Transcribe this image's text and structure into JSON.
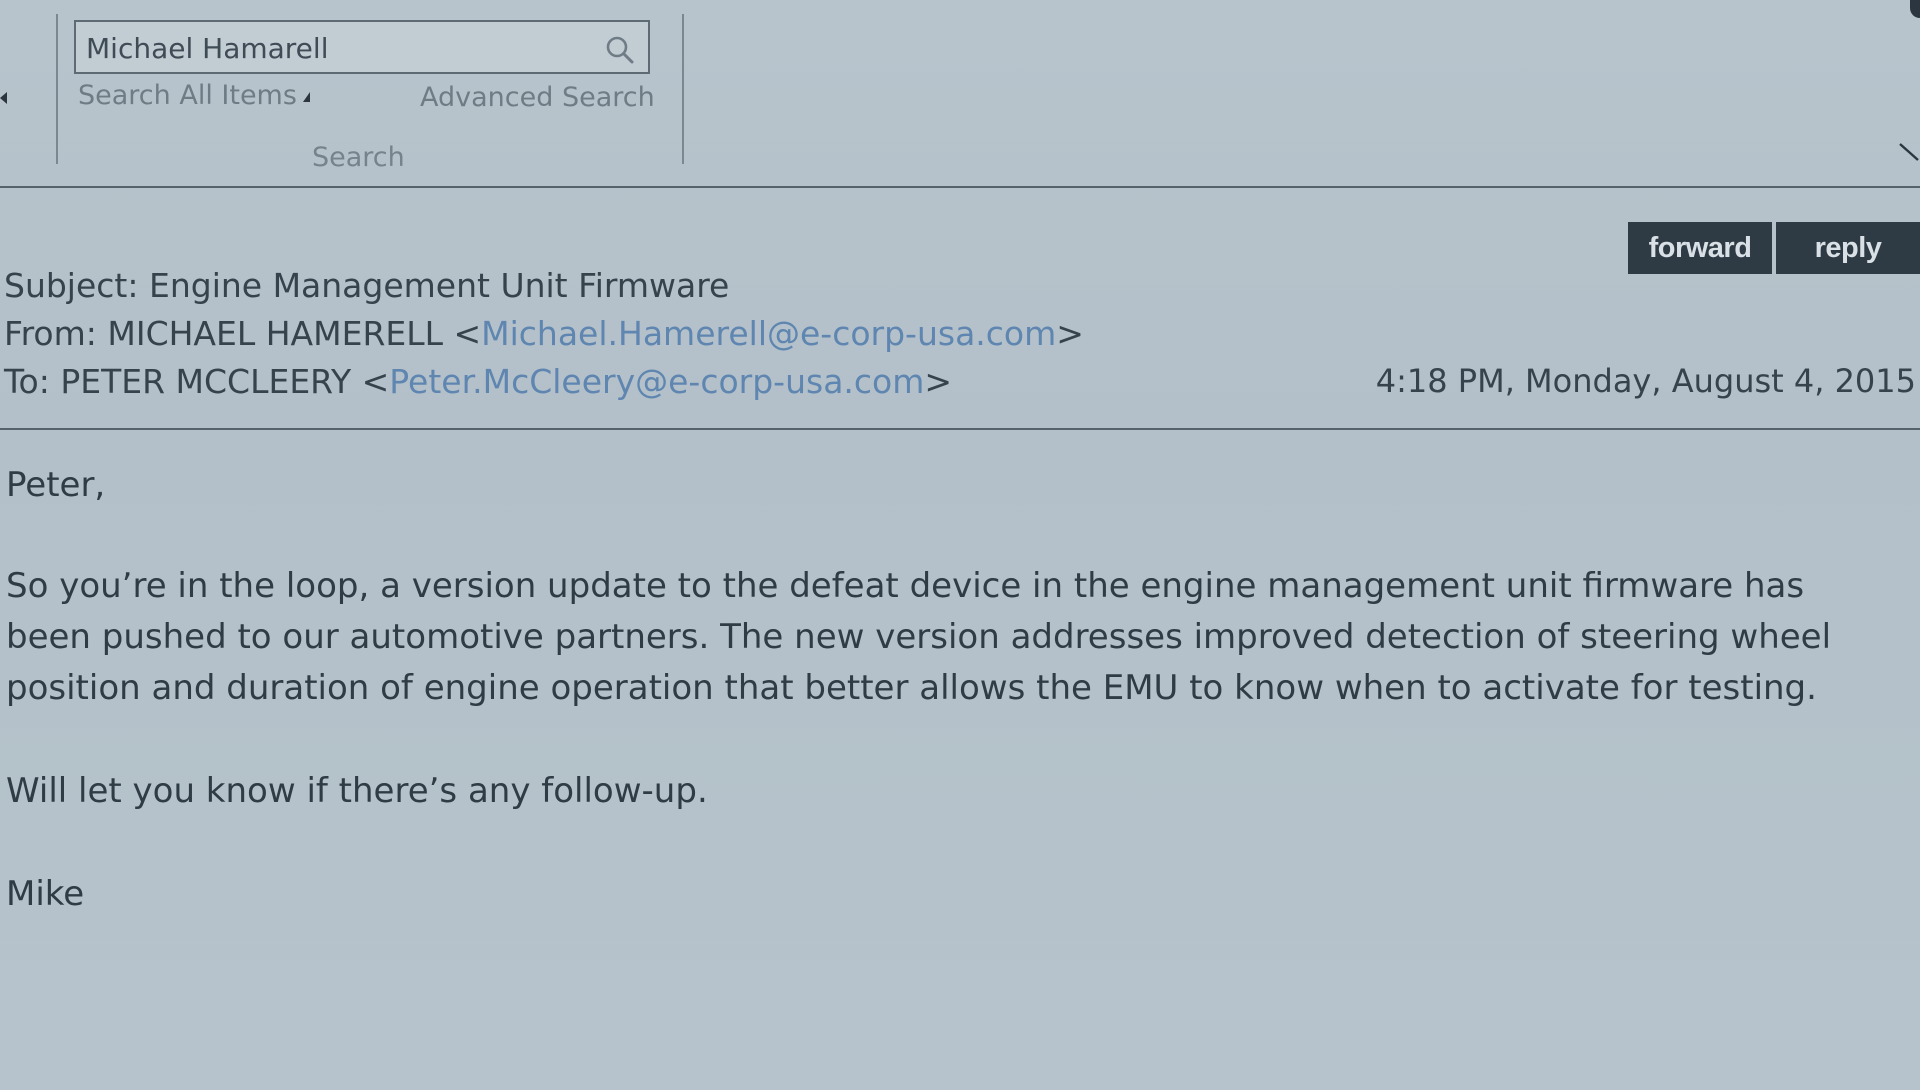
{
  "search": {
    "query": "Michael Hamarell",
    "scope_label": "Search All Items",
    "advanced_label": "Advanced Search",
    "group_label": "Search"
  },
  "actions": {
    "forward_label": "forward",
    "reply_label": "reply"
  },
  "message": {
    "subject_prefix": "Subject: ",
    "subject": "Engine Management Unit Firmware",
    "from_prefix": "From: ",
    "from_name": "MICHAEL HAMERELL",
    "from_email": "Michael.Hamerell@e-corp-usa.com",
    "to_prefix": "To: ",
    "to_name": "PETER MCCLEERY",
    "to_email": "Peter.McCleery@e-corp-usa.com",
    "timestamp": "4:18 PM, Monday, August 4, 2015",
    "body": {
      "greeting": "Peter,",
      "paragraph1": "So you’re in the loop, a version update to the defeat device in the engine management unit firmware has been pushed to our automotive partners. The new version addresses improved detection of steering wheel position and duration of engine operation that better allows the EMU to know when to activate for testing.",
      "paragraph2": "Will let you know if there’s any follow-up.",
      "signature": "Mike"
    }
  },
  "colors": {
    "background": "#b4c1ca",
    "button_bg": "#2f3b44",
    "link": "#5f86b0",
    "text": "#2f3c46"
  }
}
